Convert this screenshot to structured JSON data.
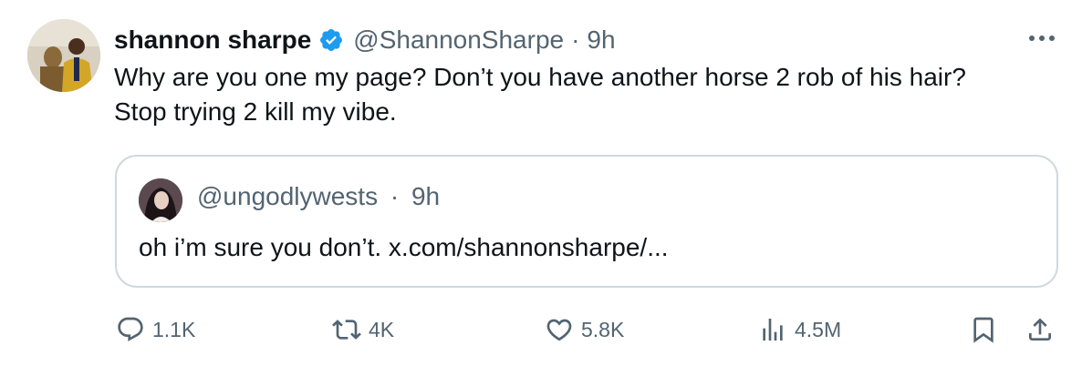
{
  "author": {
    "name": "shannon sharpe",
    "handle": "@ShannonSharpe",
    "time": "9h"
  },
  "body": {
    "lines": [
      "Why are you one my page? Don’t you have another horse 2 rob of his hair?",
      "Stop trying 2 kill my vibe."
    ]
  },
  "quote": {
    "handle": "@ungodlywests",
    "time": "9h",
    "text": "oh i’m sure you don’t. x.com/shannonsharpe/..."
  },
  "actions": {
    "replies": "1.1K",
    "reposts": "4K",
    "likes": "5.8K",
    "views": "4.5M"
  },
  "separator": "·",
  "colors": {
    "verified": "#1d9bf0",
    "secondary_text": "#536471",
    "border": "#cfd9de",
    "primary_text": "#0f1419"
  },
  "icons": [
    "verified-badge-icon",
    "more-icon",
    "reply-icon",
    "repost-icon",
    "like-icon",
    "views-icon",
    "bookmark-icon",
    "share-icon"
  ]
}
